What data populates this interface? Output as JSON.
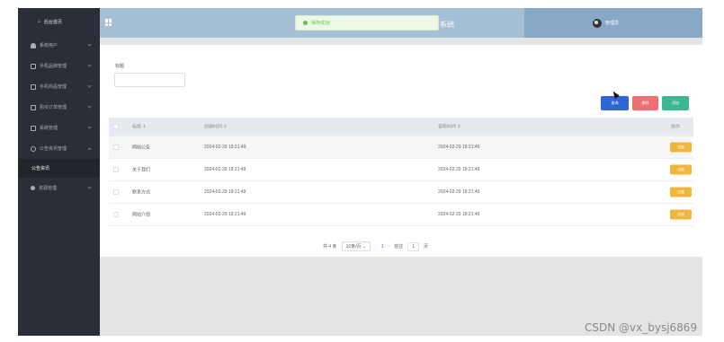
{
  "sidebar": {
    "home_label": "后台首页",
    "items": [
      {
        "label": "系统用户",
        "icon": "user-icon"
      },
      {
        "label": "手机品牌管理",
        "icon": "box-icon"
      },
      {
        "label": "手机商品管理",
        "icon": "box-icon"
      },
      {
        "label": "购买订单管理",
        "icon": "box-icon"
      },
      {
        "label": "系统管理",
        "icon": "grid-icon"
      },
      {
        "label": "公告资讯管理",
        "icon": "info-icon"
      }
    ],
    "sub_item": "公告资讯",
    "last_item": {
      "label": "资源管理",
      "icon": "dot-icon"
    }
  },
  "header": {
    "system_title": "序系统",
    "user_name": "管理员"
  },
  "toast": {
    "message": "保存成功!"
  },
  "filter": {
    "label": "标题",
    "value": ""
  },
  "actions": {
    "search": "查询",
    "delete": "删除",
    "add": "添加"
  },
  "table": {
    "headers": {
      "title": "标题 ⇕",
      "created": "创建时间 ⇕",
      "updated": "更新时间 ⇕",
      "operation": "操作"
    },
    "detail_label": "详情",
    "rows": [
      {
        "title": "网站公告",
        "created": "2024-02-29 18:21:49",
        "updated": "2024-02-29 18:21:49"
      },
      {
        "title": "关于我们",
        "created": "2024-02-29 18:21:49",
        "updated": "2024-02-29 18:21:49"
      },
      {
        "title": "联系方式",
        "created": "2024-02-29 18:21:49",
        "updated": "2024-02-29 18:21:49"
      },
      {
        "title": "网站介绍",
        "created": "2024-02-29 18:21:49",
        "updated": "2024-02-29 18:21:49"
      }
    ]
  },
  "pagination": {
    "total": "共 4 条",
    "page_size": "10条/页 ⌄",
    "prev": "‹",
    "current": "1",
    "next": "›",
    "goto_label": "前往",
    "goto_value": "1",
    "page_suffix": "页"
  },
  "watermark": "CSDN @vx_bysj6869"
}
